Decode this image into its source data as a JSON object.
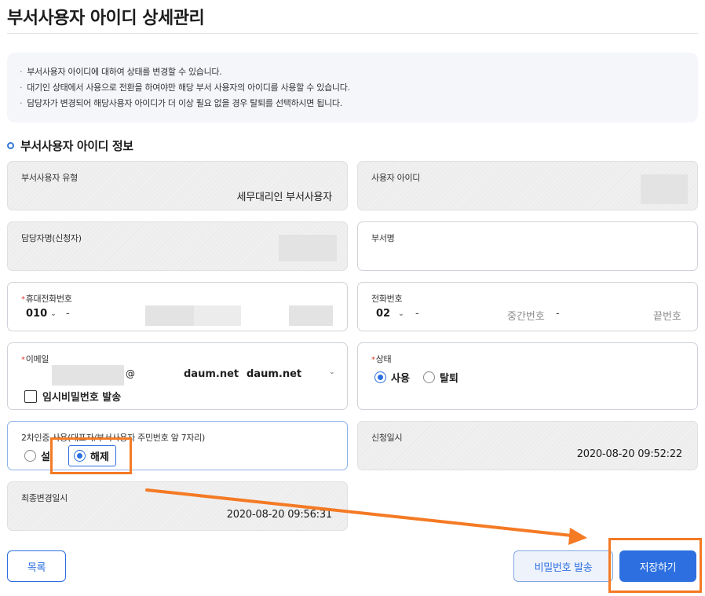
{
  "page": {
    "title": "부서사용자 아이디 상세관리"
  },
  "notice": {
    "bullet": "·",
    "items": [
      "부서사용자 아이디에 대하여 상태를 변경할 수 있습니다.",
      "대기인 상태에서 사용으로 전환을 하여야만 해당 부서 사용자의 아이디를 사용할 수 있습니다.",
      "담당자가 변경되어 해당사용자 아이디가 더 이상 필요 없을 경우 탈퇴를 선택하시면 됩니다."
    ]
  },
  "section": {
    "title": "부서사용자 아이디 정보"
  },
  "fields": {
    "user_type": {
      "label": "부서사용자 유형",
      "value": "세무대리인 부서사용자"
    },
    "user_id": {
      "label": "사용자 아이디"
    },
    "manager_name": {
      "label": "담당자명(신청자)"
    },
    "dept_name": {
      "label": "부서명"
    },
    "mobile": {
      "label": "휴대전화번호",
      "required_mark": "*",
      "prefix": "010",
      "dash": "-"
    },
    "phone": {
      "label": "전화번호",
      "prefix": "02",
      "dash": "-",
      "middle_placeholder": "중간번호",
      "last_placeholder": "끝번호"
    },
    "email": {
      "label": "이메일",
      "required_mark": "*",
      "at": "@",
      "domain_text": "daum.net",
      "domain_select": "daum.net",
      "temp_pw_label": "임시비밀번호 발송"
    },
    "status": {
      "label": "상태",
      "required_mark": "*",
      "options": [
        "사용",
        "탈퇴"
      ],
      "selected": "사용"
    },
    "second_auth": {
      "label": "2차인증 사용(대표자/부서사용자 주민번호 앞 7자리)",
      "options": [
        "설정",
        "해제"
      ],
      "option_set_visible": "설",
      "selected": "해제"
    },
    "applied_at": {
      "label": "신청일시",
      "value": "2020-08-20 09:52:22"
    },
    "modified_at": {
      "label": "최종변경일시",
      "value": "2020-08-20 09:56:31"
    }
  },
  "buttons": {
    "list": "목록",
    "send_password": "비밀번호 발송",
    "save": "저장하기"
  },
  "colors": {
    "accent": "#2d6fe0",
    "annotation": "#f47a24",
    "required": "#e03c31"
  }
}
